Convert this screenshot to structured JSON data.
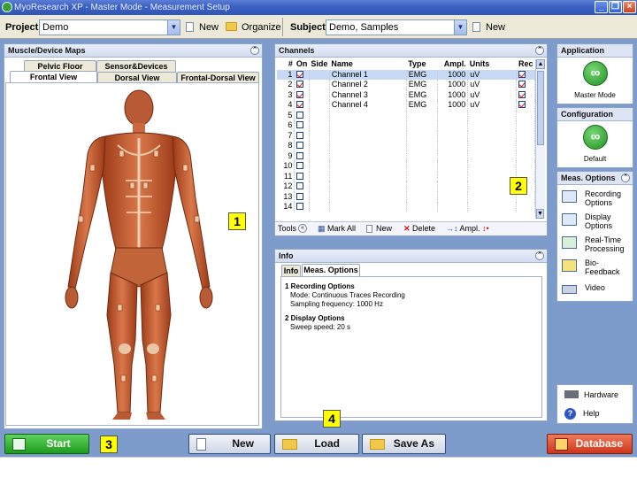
{
  "window": {
    "title": "MyoResearch XP - Master Mode - Measurement Setup"
  },
  "toolbar": {
    "project_label": "Project",
    "project_value": "Demo",
    "project_new": "New",
    "project_organize": "Organize",
    "subject_label": "Subject",
    "subject_value": "Demo, Samples",
    "subject_new": "New"
  },
  "maps": {
    "header": "Muscle/Device Maps",
    "tabs_back": [
      "Pelvic Floor",
      "Sensor&Devices"
    ],
    "tabs_front": [
      "Frontal View",
      "Dorsal View",
      "Frontal-Dorsal View"
    ],
    "active_tab": "Frontal View"
  },
  "channels": {
    "header": "Channels",
    "columns": [
      "#",
      "On",
      "Side",
      "Name",
      "Type",
      "Ampl.",
      "Units",
      "Rec"
    ],
    "rows": [
      {
        "num": "1",
        "on": true,
        "name": "Channel 1",
        "type": "EMG",
        "ampl": "1000",
        "units": "uV",
        "rec": true
      },
      {
        "num": "2",
        "on": true,
        "name": "Channel 2",
        "type": "EMG",
        "ampl": "1000",
        "units": "uV",
        "rec": true
      },
      {
        "num": "3",
        "on": true,
        "name": "Channel 3",
        "type": "EMG",
        "ampl": "1000",
        "units": "uV",
        "rec": true
      },
      {
        "num": "4",
        "on": true,
        "name": "Channel 4",
        "type": "EMG",
        "ampl": "1000",
        "units": "uV",
        "rec": true
      },
      {
        "num": "5",
        "on": false
      },
      {
        "num": "6",
        "on": false
      },
      {
        "num": "7",
        "on": false
      },
      {
        "num": "8",
        "on": false
      },
      {
        "num": "9",
        "on": false
      },
      {
        "num": "10",
        "on": false
      },
      {
        "num": "11",
        "on": false
      },
      {
        "num": "12",
        "on": false
      },
      {
        "num": "13",
        "on": false
      },
      {
        "num": "14",
        "on": false
      }
    ],
    "tools": {
      "label": "Tools",
      "mark_all": "Mark All",
      "new": "New",
      "delete": "Delete",
      "ampl": "Ampl."
    }
  },
  "info": {
    "header": "Info",
    "tabs": [
      "Info",
      "Meas. Options"
    ],
    "active_tab": "Meas. Options",
    "sections": [
      {
        "title": "1 Recording Options",
        "lines": [
          "Mode: Continuous Traces Recording",
          "Sampling frequency: 1000 Hz"
        ]
      },
      {
        "title": "2 Display Options",
        "lines": [
          "Sweep speed: 20 s"
        ]
      }
    ]
  },
  "side": {
    "application_header": "Application",
    "application_label": "Master Mode",
    "configuration_header": "Configuration",
    "configuration_label": "Default",
    "meas_header": "Meas. Options",
    "options": [
      {
        "label": "Recording Options",
        "icon": "recording-options-icon"
      },
      {
        "label": "Display Options",
        "icon": "display-options-icon"
      },
      {
        "label": "Real-Time Processing",
        "icon": "realtime-processing-icon"
      },
      {
        "label": "Bio-Feedback",
        "icon": "biofeedback-icon"
      },
      {
        "label": "Video",
        "icon": "video-icon"
      }
    ],
    "hardware": "Hardware",
    "help": "Help"
  },
  "bottom": {
    "start": "Start",
    "new": "New",
    "load": "Load",
    "save_as": "Save As",
    "database": "Database"
  },
  "callouts": [
    "1",
    "2",
    "3",
    "4"
  ]
}
